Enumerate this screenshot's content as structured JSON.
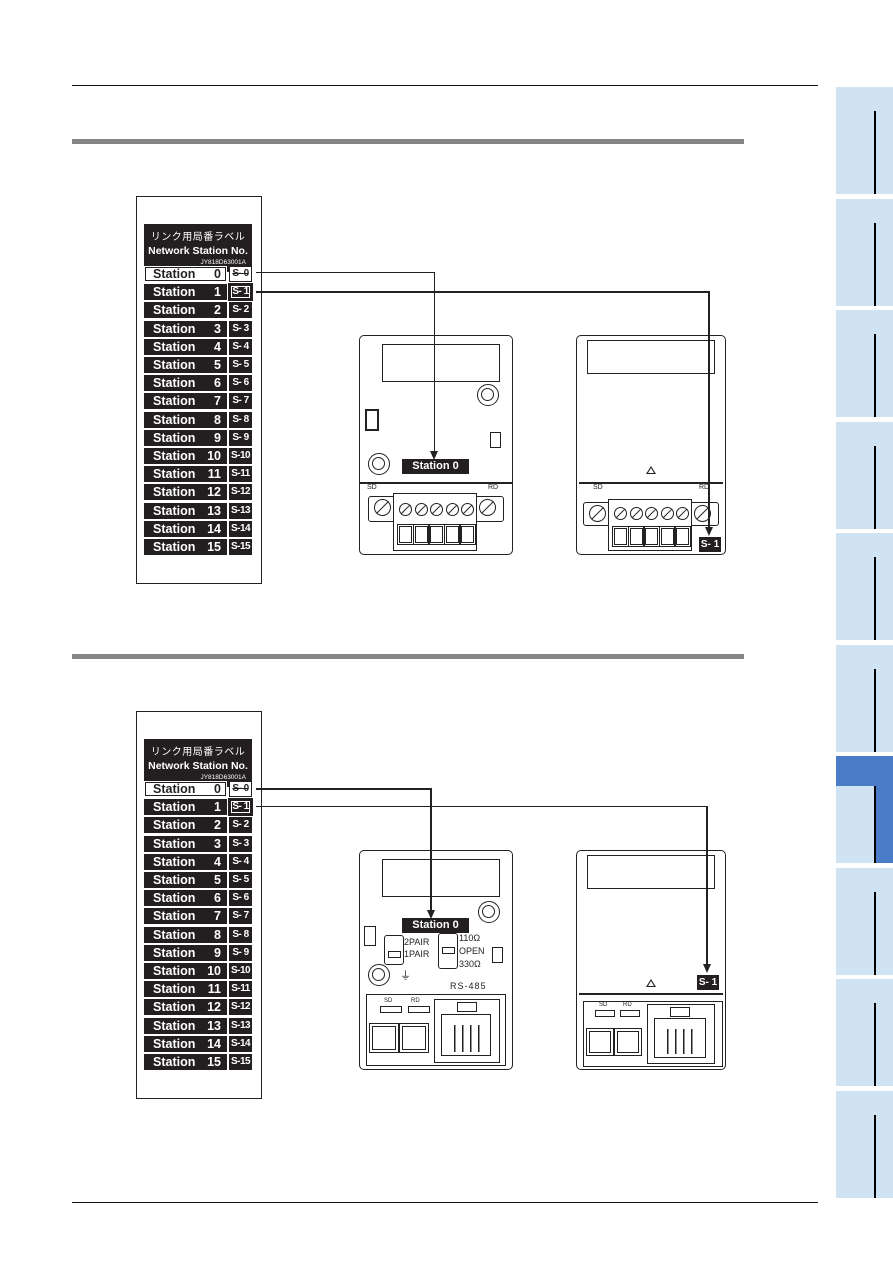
{
  "side_tabs": {
    "count": 10,
    "active_index": 6,
    "colors": {
      "inactive": "#cfe3f3",
      "active": "#4a7cc7"
    }
  },
  "label_sheet": {
    "title_jp": "リンク用局番ラベル",
    "title_en": "Network Station No.",
    "part_code": "JY818D63001A",
    "rows": [
      {
        "word": "Station",
        "num": "0",
        "short": "S- 0"
      },
      {
        "word": "Station",
        "num": "1",
        "short": "S- 1"
      },
      {
        "word": "Station",
        "num": "2",
        "short": "S- 2"
      },
      {
        "word": "Station",
        "num": "3",
        "short": "S- 3"
      },
      {
        "word": "Station",
        "num": "4",
        "short": "S- 4"
      },
      {
        "word": "Station",
        "num": "5",
        "short": "S- 5"
      },
      {
        "word": "Station",
        "num": "6",
        "short": "S- 6"
      },
      {
        "word": "Station",
        "num": "7",
        "short": "S- 7"
      },
      {
        "word": "Station",
        "num": "8",
        "short": "S- 8"
      },
      {
        "word": "Station",
        "num": "9",
        "short": "S- 9"
      },
      {
        "word": "Station",
        "num": "10",
        "short": "S-10"
      },
      {
        "word": "Station",
        "num": "11",
        "short": "S-11"
      },
      {
        "word": "Station",
        "num": "12",
        "short": "S-12"
      },
      {
        "word": "Station",
        "num": "13",
        "short": "S-13"
      },
      {
        "word": "Station",
        "num": "14",
        "short": "S-14"
      },
      {
        "word": "Station",
        "num": "15",
        "short": "S-15"
      }
    ]
  },
  "section1": {
    "device_a": {
      "badge": "Station   0",
      "sd": "SD",
      "rd": "RD"
    },
    "device_b": {
      "badge": "S- 1",
      "sd": "SD",
      "rd": "RD"
    }
  },
  "section2": {
    "device_a": {
      "badge": "Station   0",
      "switch1": [
        "2PAIR",
        "1PAIR"
      ],
      "switch2": [
        "110Ω",
        "OPEN",
        "330Ω"
      ],
      "port_label": "RS-485",
      "sd": "SD",
      "rd": "RD"
    },
    "device_b": {
      "badge": "S- 1",
      "sd": "SD",
      "rd": "RD"
    }
  }
}
